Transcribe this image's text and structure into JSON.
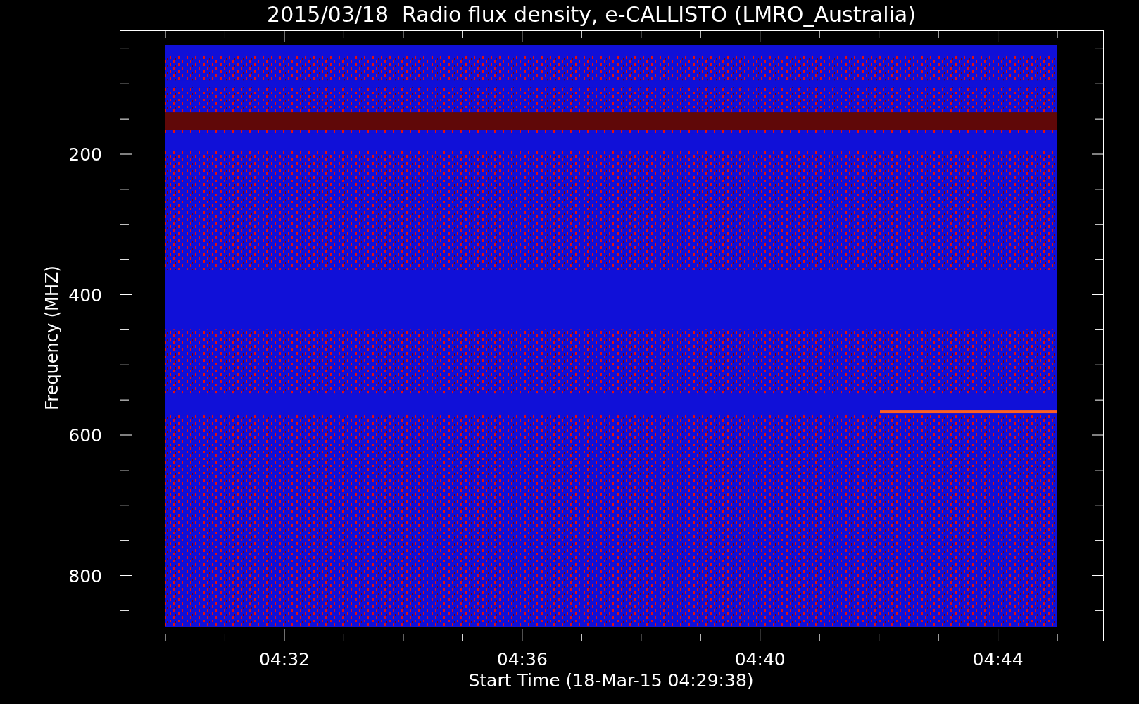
{
  "title": "2015/03/18  Radio flux density, e-CALLISTO (LMRO_Australia)",
  "y_axis": {
    "label": "Frequency (MHZ)",
    "ticks": [
      "200",
      "400",
      "600",
      "800"
    ]
  },
  "x_axis": {
    "label": "Start Time (18-Mar-15 04:29:38)",
    "ticks": [
      "04:32",
      "04:36",
      "04:40",
      "04:44"
    ]
  }
}
